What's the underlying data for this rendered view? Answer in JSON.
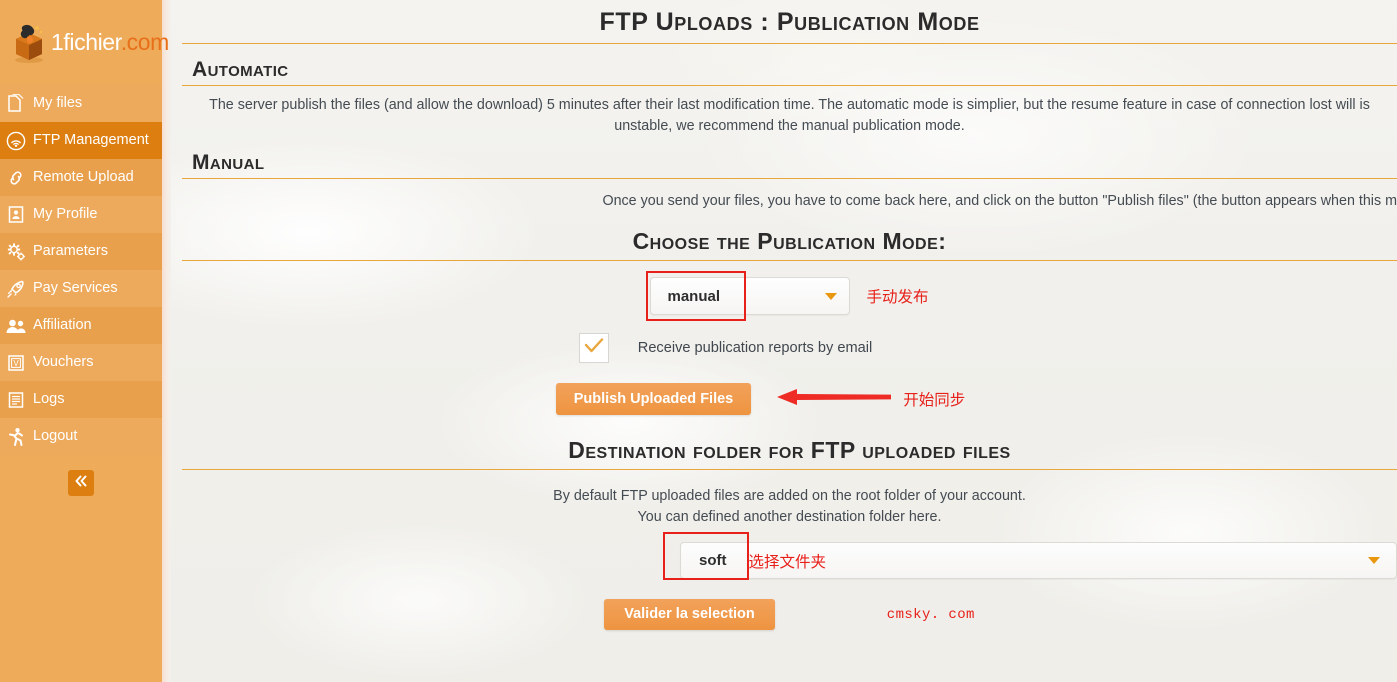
{
  "sidebar": {
    "logo": {
      "name_white": "1fichier",
      "name_orange": ".com"
    },
    "items": [
      {
        "label": "My files",
        "icon": "files-icon",
        "active": false
      },
      {
        "label": "FTP Management",
        "icon": "ftp-wifi-icon",
        "active": true
      },
      {
        "label": "Remote Upload",
        "icon": "link-icon",
        "active": false
      },
      {
        "label": "My Profile",
        "icon": "profile-card-icon",
        "active": false
      },
      {
        "label": "Parameters",
        "icon": "gears-icon",
        "active": false
      },
      {
        "label": "Pay Services",
        "icon": "rocket-icon",
        "active": false
      },
      {
        "label": "Affiliation",
        "icon": "people-icon",
        "active": false
      },
      {
        "label": "Vouchers",
        "icon": "voucher-icon",
        "active": false
      },
      {
        "label": "Logs",
        "icon": "list-icon",
        "active": false
      },
      {
        "label": "Logout",
        "icon": "running-person-icon",
        "active": false
      }
    ],
    "collapse_icon": "double-chevron-left-icon"
  },
  "page": {
    "title": "FTP Uploads : Publication Mode",
    "sections": {
      "automatic": {
        "heading": "Automatic",
        "text": "The server publish the files (and allow the download) 5 minutes after their last modification time. The automatic mode is simplier, but the resume feature in case of connection lost will is unstable, we recommend the manual publication mode."
      },
      "manual": {
        "heading": "Manual",
        "text": "Once you send your files, you have to come back here, and click on the button \"Publish files\" (the button appears when this m"
      },
      "choose_mode": {
        "heading": "Choose the Publication Mode:",
        "select_value": "manual",
        "select_annotation": "手动发布",
        "caret_icon": "chevron-down-icon",
        "checkbox_checked": true,
        "checkbox_icon": "checkmark-icon",
        "checkbox_label": "Receive publication reports by email",
        "publish_button": "Publish Uploaded Files",
        "publish_annotation": "开始同步",
        "arrow_icon": "arrow-left-icon"
      },
      "destination": {
        "heading": "Destination folder for FTP uploaded files",
        "text_line1": "By default FTP uploaded files are added on the root folder of your account.",
        "text_line2": "You can defined another destination folder here.",
        "select_value": "soft",
        "select_annotation": "选择文件夹",
        "caret_icon": "chevron-down-icon",
        "validate_button": "Valider la selection"
      }
    },
    "watermark": "cmsky. com"
  },
  "colors": {
    "sidebar_light": "#edaa5d",
    "sidebar_alt": "#e9a04c",
    "sidebar_active": "#dd7f10",
    "accent_orange": "#e8a63c",
    "button_orange": "#ee9440",
    "annotation_red": "#e8201a",
    "background": "#f1f0ec"
  }
}
